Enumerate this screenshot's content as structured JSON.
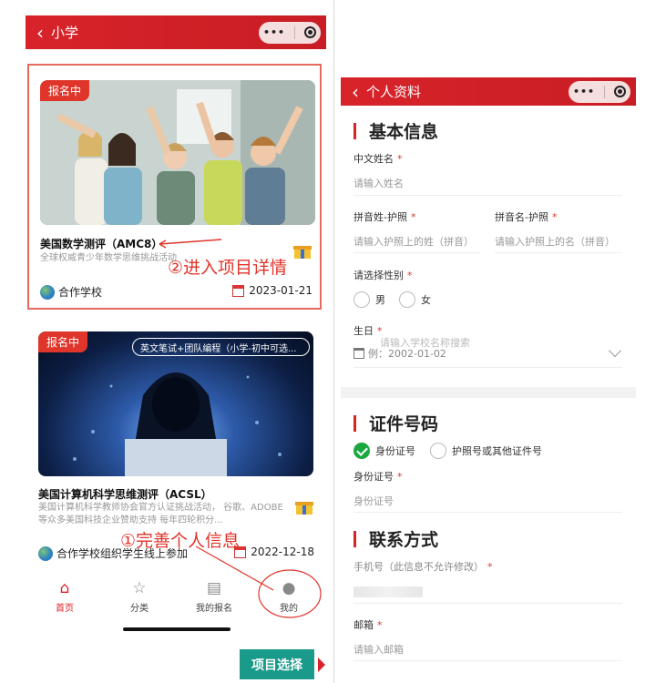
{
  "left": {
    "nav": {
      "back": "‹",
      "title": "小学"
    },
    "cards": [
      {
        "badge": "报名中",
        "title": "美国数学测评（AMC8）",
        "desc": "全球权威青少年数学思维挑战活动",
        "org": "合作学校",
        "date": "2023-01-21",
        "image": "students-celebrating"
      },
      {
        "badge": "报名中",
        "tag": "英文笔试+团队编程（小学-初中可选...",
        "title": "美国计算机科学思维测评（ACSL）",
        "desc": "美国计算机科学教师协会官方认证挑战活动， 谷歌、ADOBE 等众多美国科技企业赞助支持 每年四轮积分...",
        "org": "合作学校组织学生线上参加",
        "date": "2022-12-18",
        "image": "hooded-hacker-laptop"
      }
    ],
    "tabs": [
      {
        "label": "首页",
        "icon": "home-icon",
        "active": true
      },
      {
        "label": "分类",
        "icon": "star-icon",
        "active": false
      },
      {
        "label": "我的报名",
        "icon": "document-icon",
        "active": false
      },
      {
        "label": "我的",
        "icon": "person-icon",
        "active": false
      }
    ],
    "annotations": {
      "step2": "②进入项目详情",
      "step1": "①完善个人信息"
    },
    "project_button": "项目选择"
  },
  "right": {
    "nav": {
      "back": "‹",
      "title": "个人资料"
    },
    "section_basic": "基本信息",
    "cn_name_label": "中文姓名",
    "cn_name_ph": "请输入姓名",
    "last_name_label": "拼音姓-护照",
    "last_name_ph": "请输入护照上的姓（拼音）",
    "first_name_label": "拼音名-护照",
    "first_name_ph": "请输入护照上的名（拼音）",
    "gender_label": "请选择性别",
    "gender_male": "男",
    "gender_female": "女",
    "birthday_label": "生日",
    "school_ph": "请输入学校名称搜索",
    "birthday_ph": "例：2002-01-02",
    "section_id": "证件号码",
    "id_opt1": "身份证号",
    "id_opt2": "护照号或其他证件号",
    "id_label": "身份证号",
    "id_ph": "身份证号",
    "section_contact": "联系方式",
    "phone_label": "手机号（此信息不允许修改）",
    "email_label": "邮箱",
    "email_ph": "请输入邮箱",
    "required_mark": "*"
  },
  "colors": {
    "brand_red": "#d8232a",
    "accent_green": "#18a83e",
    "teal": "#1a9a8a"
  }
}
